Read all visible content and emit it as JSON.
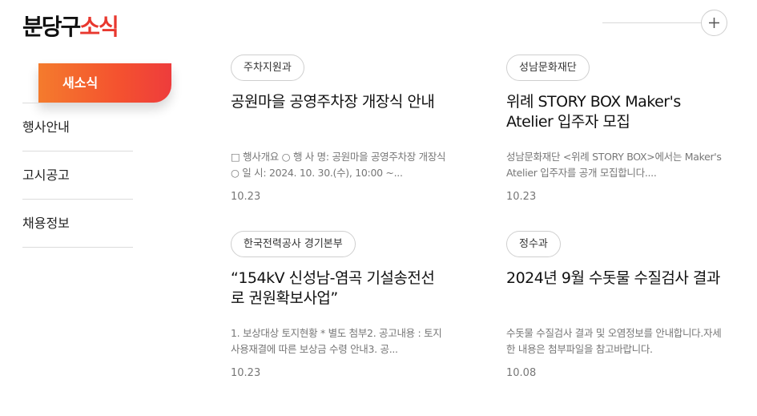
{
  "header": {
    "title_part1": "분당구",
    "title_part2": "소식",
    "more_icon": "plus-icon"
  },
  "sidebar": {
    "items": [
      {
        "label": "새소식"
      },
      {
        "label": "행사안내"
      },
      {
        "label": "고시공고"
      },
      {
        "label": "채용정보"
      }
    ]
  },
  "cards": [
    {
      "tag": "주차지원과",
      "title": "공원마을 공영주차장 개장식 안내",
      "desc": "□ 행사개요 ○ 행 사 명: 공원마을 공영주차장 개장식 ○ 일 시: 2024. 10. 30.(수), 10:00 ~...",
      "date": "10.23"
    },
    {
      "tag": "성남문화재단",
      "title": "위례 STORY BOX Maker's Atelier 입주자 모집",
      "desc": "성남문화재단 <위례 STORY BOX>에서는 Maker's Atelier 입주자를 공개 모집합니다....",
      "date": "10.23"
    },
    {
      "tag": "한국전력공사 경기본부",
      "title": "“154kV 신성남-염곡 기설송전선로 권원확보사업”",
      "desc": "1. 보상대상 토지현황 * 별도 첨부2. 공고내용 : 토지사용재결에 따른 보상금 수령 안내3. 공...",
      "date": "10.23"
    },
    {
      "tag": "정수과",
      "title": "2024년 9월 수돗물 수질검사 결과",
      "desc": "수돗물 수질검사 결과 및 오염정보를 안내합니다.자세한 내용은 첨부파일을 참고바랍니다.",
      "date": "10.08"
    }
  ]
}
